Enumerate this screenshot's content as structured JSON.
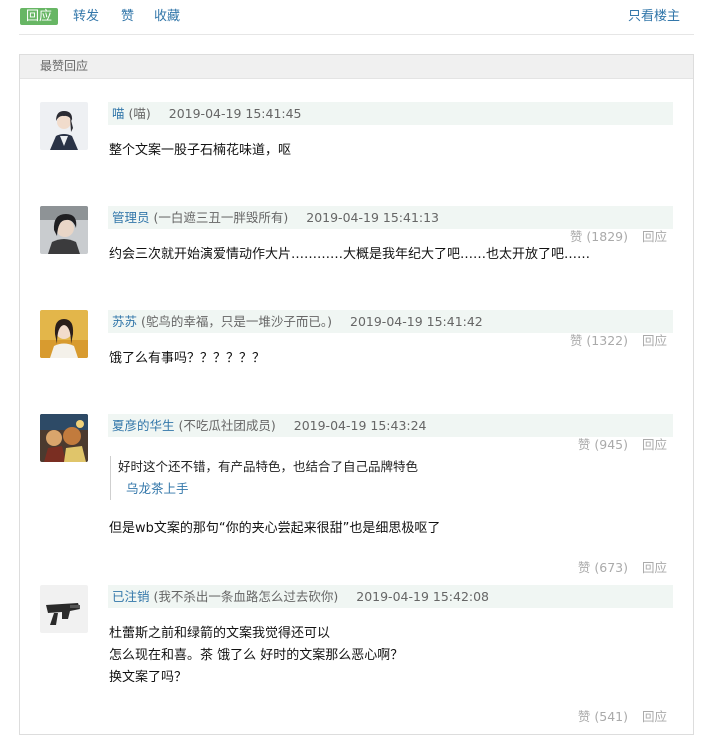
{
  "tabs": {
    "reply": "回应",
    "forward": "转发",
    "like": "赞",
    "collect": "收藏",
    "only_author": "只看楼主"
  },
  "panel": {
    "title": "最赞回应"
  },
  "comments": [
    {
      "user": "喵",
      "signature": "(喵)",
      "time": "2019-04-19 15:41:45",
      "text": [
        "整个文案一股子石楠花味道，呕"
      ],
      "likes": "赞 (1829)",
      "reply": "回应"
    },
    {
      "user": "管理员",
      "signature": "(一白遮三丑一胖毁所有)",
      "time": "2019-04-19 15:41:13",
      "text": [
        "约会三次就开始演爱情动作大片…………大概是我年纪大了吧……也太开放了吧……"
      ],
      "likes": "赞 (1322)",
      "reply": "回应"
    },
    {
      "user": "苏苏",
      "signature": "(鸵鸟的幸福，只是一堆沙子而已。)",
      "time": "2019-04-19 15:41:42",
      "text": [
        "饿了么有事吗？？？？？？"
      ],
      "likes": "赞 (945)",
      "reply": "回应"
    },
    {
      "user": "夏彦的华生",
      "signature": "(不吃瓜社团成员)",
      "time": "2019-04-19 15:43:24",
      "quote": {
        "text": "好时这个还不错，有产品特色，也结合了自己品牌特色",
        "user": "乌龙茶上手"
      },
      "text": [
        "但是wb文案的那句“你的夹心尝起来很甜”也是细思极呕了"
      ],
      "likes": "赞 (673)",
      "reply": "回应"
    },
    {
      "user": "已注销",
      "signature": "(我不杀出一条血路怎么过去砍你)",
      "time": "2019-04-19 15:42:08",
      "text": [
        "杜蕾斯之前和绿箭的文案我觉得还可以",
        "怎么现在和喜。茶 饿了么 好时的文案那么恶心啊？",
        "换文案了吗？"
      ],
      "likes": "赞 (541)",
      "reply": "回应"
    }
  ]
}
